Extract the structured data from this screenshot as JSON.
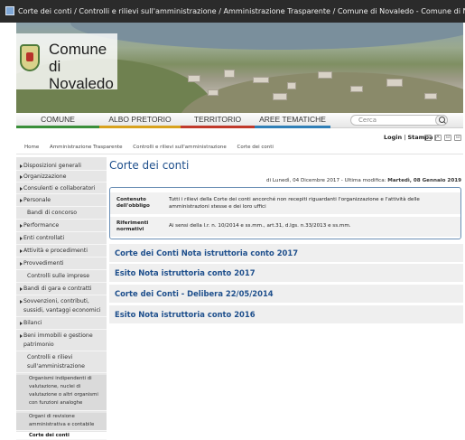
{
  "window": {
    "title": "Corte dei conti / Controlli e rilievi sull'amministrazione / Amministrazione Trasparente / Comune di Novaledo - Comune di Novaledo"
  },
  "logo": {
    "line1": "Comune di",
    "line2": "Novaledo"
  },
  "nav": {
    "items": [
      {
        "label": "COMUNE",
        "underline": "#3a8f3a"
      },
      {
        "label": "ALBO PRETORIO",
        "underline": "#d8a21e"
      },
      {
        "label": "TERRITORIO",
        "underline": "#c0392b"
      },
      {
        "label": "AREE TEMATICHE",
        "underline": "#2f7fb7"
      }
    ],
    "search_placeholder": "Cerca"
  },
  "utility": {
    "login": "Login",
    "stampa": "Stampa",
    "sep": "|"
  },
  "a11y": [
    "+",
    "A",
    "⊟",
    "⊟"
  ],
  "breadcrumb": [
    "Home",
    "Amministrazione Trasparente",
    "Controlli e rilievi sull'amministrazione",
    "Corte dei conti"
  ],
  "sidebar": {
    "items": [
      {
        "label": "Disposizioni generali",
        "arrow": true
      },
      {
        "label": "Organizzazione",
        "arrow": true
      },
      {
        "label": "Consulenti e collaboratori",
        "arrow": true
      },
      {
        "label": "Personale",
        "arrow": true
      },
      {
        "label": "Bandi di concorso",
        "arrow": false
      },
      {
        "label": "Performance",
        "arrow": true
      },
      {
        "label": "Enti controllati",
        "arrow": true
      },
      {
        "label": "Attività e procedimenti",
        "arrow": true
      },
      {
        "label": "Provvedimenti",
        "arrow": true
      },
      {
        "label": "Controlli sulle imprese",
        "arrow": false
      },
      {
        "label": "Bandi di gara e contratti",
        "arrow": true
      },
      {
        "label": "Sovvenzioni, contributi, sussidi, vantaggi economici",
        "arrow": true
      },
      {
        "label": "Bilanci",
        "arrow": true
      },
      {
        "label": "Beni immobili e gestione patrimonio",
        "arrow": true
      },
      {
        "label": "Controlli e rilievi sull'amministrazione",
        "arrow": false
      },
      {
        "label": "Organismi indipendenti di valutazione, nuclei di valutazione o altri organismi con funzioni analoghe",
        "arrow": false
      },
      {
        "label": "Organi di revisione amministrativa e contabile",
        "arrow": false
      },
      {
        "label": "Corte dei conti",
        "arrow": false
      }
    ]
  },
  "main": {
    "title": "Corte dei conti",
    "dates_prefix": "di Lunedì, 04 Dicembre 2017 - Ultima modifica: ",
    "dates_modified": "Martedì, 08 Gennaio 2019",
    "info": [
      {
        "label": "Contenuto dell'obbligo",
        "value": "Tutti i rilievi della Corte dei conti ancorché non recepiti riguardanti l'organizzazione e l'attività delle amministrazioni stesse e dei loro uffici"
      },
      {
        "label": "Riferimenti normativi",
        "value": "Ai sensi della l.r. n. 10/2014 e ss.mm., art.31, d.lgs. n.33/2013 e ss.mm."
      }
    ],
    "documents": [
      "Corte dei Conti Nota istruttoria conto 2017",
      "Esito Nota istruttoria conto 2017",
      "Corte dei Conti - Delibera 22/05/2014",
      "Esito Nota istruttoria conto 2016"
    ]
  }
}
